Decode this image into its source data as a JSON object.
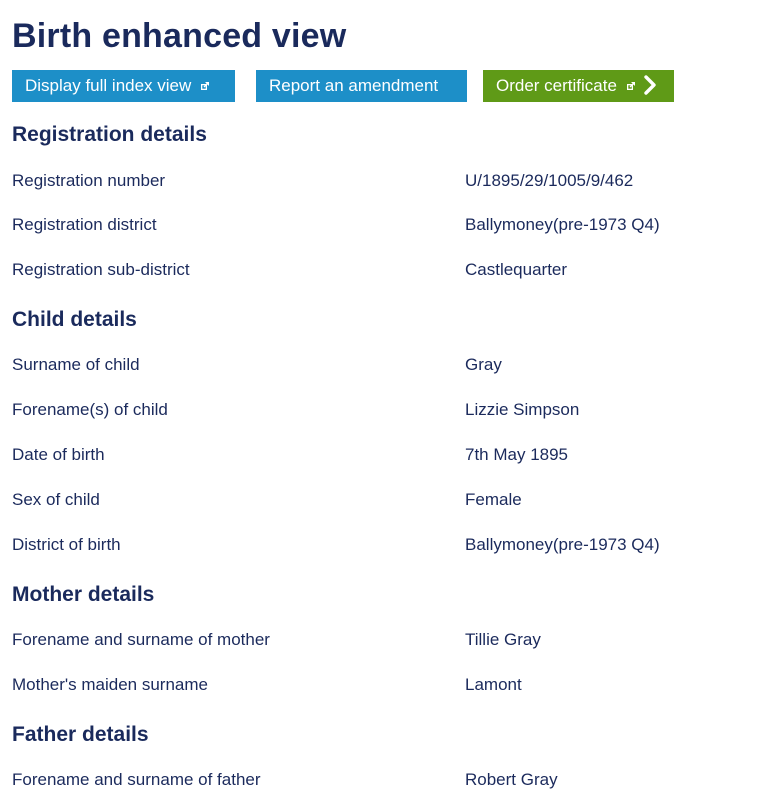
{
  "page_title": "Birth enhanced view",
  "toolbar": {
    "display_index_label": "Display full index view",
    "report_amendment_label": "Report an amendment",
    "order_certificate_label": "Order certificate",
    "colors": {
      "blue": "#1d8fc8",
      "green": "#5f9a17"
    }
  },
  "sections": {
    "registration": {
      "title": "Registration details",
      "rows": [
        {
          "label": "Registration number",
          "value": "U/1895/29/1005/9/462"
        },
        {
          "label": "Registration district",
          "value": "Ballymoney(pre-1973 Q4)"
        },
        {
          "label": "Registration sub-district",
          "value": "Castlequarter"
        }
      ]
    },
    "child": {
      "title": "Child details",
      "rows": [
        {
          "label": "Surname of child",
          "value": "Gray"
        },
        {
          "label": "Forename(s) of child",
          "value": "Lizzie Simpson"
        },
        {
          "label": "Date of birth",
          "value": "7th May 1895"
        },
        {
          "label": "Sex of child",
          "value": "Female"
        },
        {
          "label": "District of birth",
          "value": "Ballymoney(pre-1973 Q4)"
        }
      ]
    },
    "mother": {
      "title": "Mother details",
      "rows": [
        {
          "label": "Forename and surname of mother",
          "value": "Tillie Gray"
        },
        {
          "label": "Mother's maiden surname",
          "value": "Lamont"
        }
      ]
    },
    "father": {
      "title": "Father details",
      "rows": [
        {
          "label": "Forename and surname of father",
          "value": "Robert Gray"
        }
      ]
    }
  },
  "icons": [
    "external-link-icon",
    "chevron-right-icon"
  ]
}
